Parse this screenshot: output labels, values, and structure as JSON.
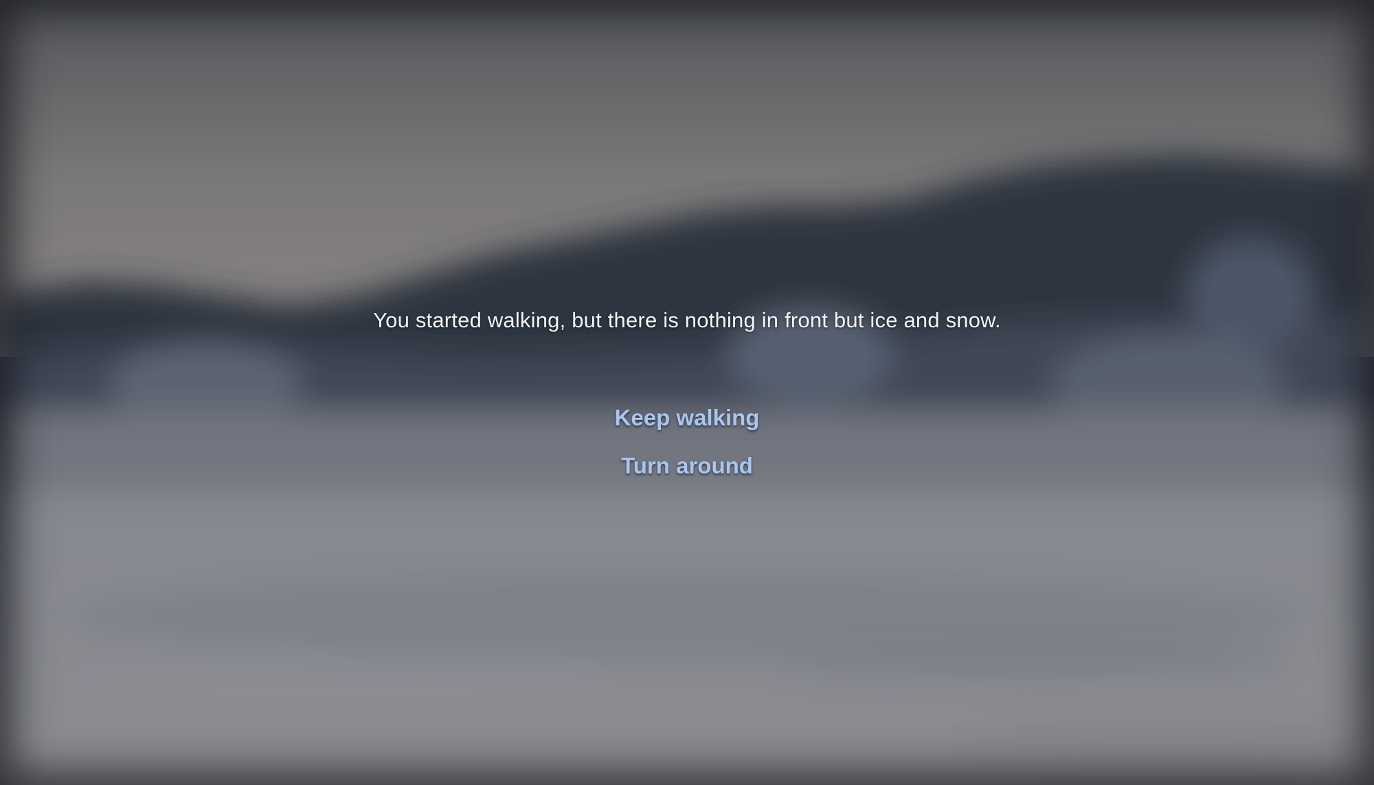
{
  "scene": {
    "narration": "You started walking, but there is nothing in front but ice and snow.",
    "choices": [
      {
        "label": "Keep walking"
      },
      {
        "label": "Turn around"
      }
    ],
    "colors": {
      "choice_text": "#a9c6ee",
      "narration_text": "#f4f5f7"
    },
    "background": "blurred-snowy-forest-and-frozen-lake"
  }
}
